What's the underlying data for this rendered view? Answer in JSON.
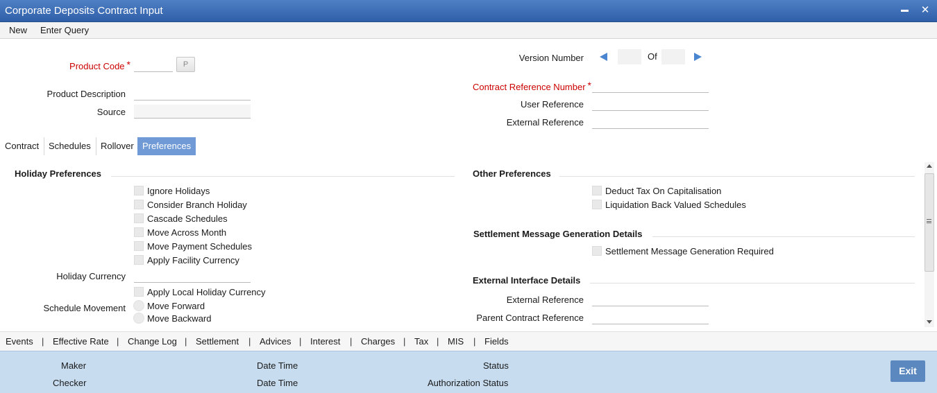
{
  "window": {
    "title": "Corporate Deposits Contract Input"
  },
  "menu": {
    "items": [
      "New",
      "Enter Query"
    ]
  },
  "header": {
    "product_code_label": "Product Code",
    "product_code_value": "",
    "p_button_label": "P",
    "product_description_label": "Product Description",
    "product_description_value": "",
    "source_label": "Source",
    "source_value": "",
    "version_number_label": "Version Number",
    "version_current": "",
    "version_of_label": "Of",
    "version_total": "",
    "contract_reference_label": "Contract Reference Number",
    "contract_reference_value": "",
    "user_reference_label": "User Reference",
    "user_reference_value": "",
    "external_reference_label": "External Reference",
    "external_reference_value": "",
    "required_marker": "*"
  },
  "tabs": [
    {
      "label": "Contract",
      "active": false
    },
    {
      "label": "Schedules",
      "active": false
    },
    {
      "label": "Rollover",
      "active": false
    },
    {
      "label": "Preferences",
      "active": true
    }
  ],
  "holiday_preferences": {
    "title": "Holiday Preferences",
    "options": [
      {
        "label": "Ignore Holidays",
        "checked": false
      },
      {
        "label": "Consider Branch Holiday",
        "checked": false
      },
      {
        "label": "Cascade Schedules",
        "checked": false
      },
      {
        "label": "Move Across Month",
        "checked": false
      },
      {
        "label": "Move Payment Schedules",
        "checked": false
      },
      {
        "label": "Apply Facility Currency",
        "checked": false
      }
    ],
    "holiday_currency_label": "Holiday Currency",
    "holiday_currency_value": "",
    "apply_local_label": "Apply Local Holiday Currency",
    "schedule_movement_label": "Schedule Movement",
    "movement_options": [
      "Move Forward",
      "Move Backward"
    ]
  },
  "other_preferences": {
    "title": "Other Preferences",
    "options": [
      {
        "label": "Deduct Tax On Capitalisation",
        "checked": false
      },
      {
        "label": "Liquidation Back Valued Schedules",
        "checked": false
      }
    ]
  },
  "settlement": {
    "title": "Settlement Message Generation Details",
    "option_label": "Settlement Message Generation Required"
  },
  "external_interface": {
    "title": "External Interface Details",
    "external_reference_label": "External Reference",
    "external_reference_value": "",
    "parent_contract_label": "Parent Contract Reference",
    "parent_contract_value": ""
  },
  "bottom_links": [
    "Events",
    "Effective Rate",
    "Change Log",
    "Settlement",
    "Advices",
    "Interest",
    "Charges",
    "Tax",
    "MIS",
    "Fields"
  ],
  "link_separator": "|",
  "footer": {
    "maker_label": "Maker",
    "checker_label": "Checker",
    "date_time_label": "Date Time",
    "status_label": "Status",
    "authorization_status_label": "Authorization Status",
    "exit_label": "Exit"
  },
  "colors": {
    "titlebar": "#3a6bb5",
    "active_tab": "#6f9ad5",
    "required_label": "#cc0000",
    "footer": "#c7dcef",
    "exit_button": "#5b88bf",
    "nav_arrow": "#4a86d0"
  }
}
